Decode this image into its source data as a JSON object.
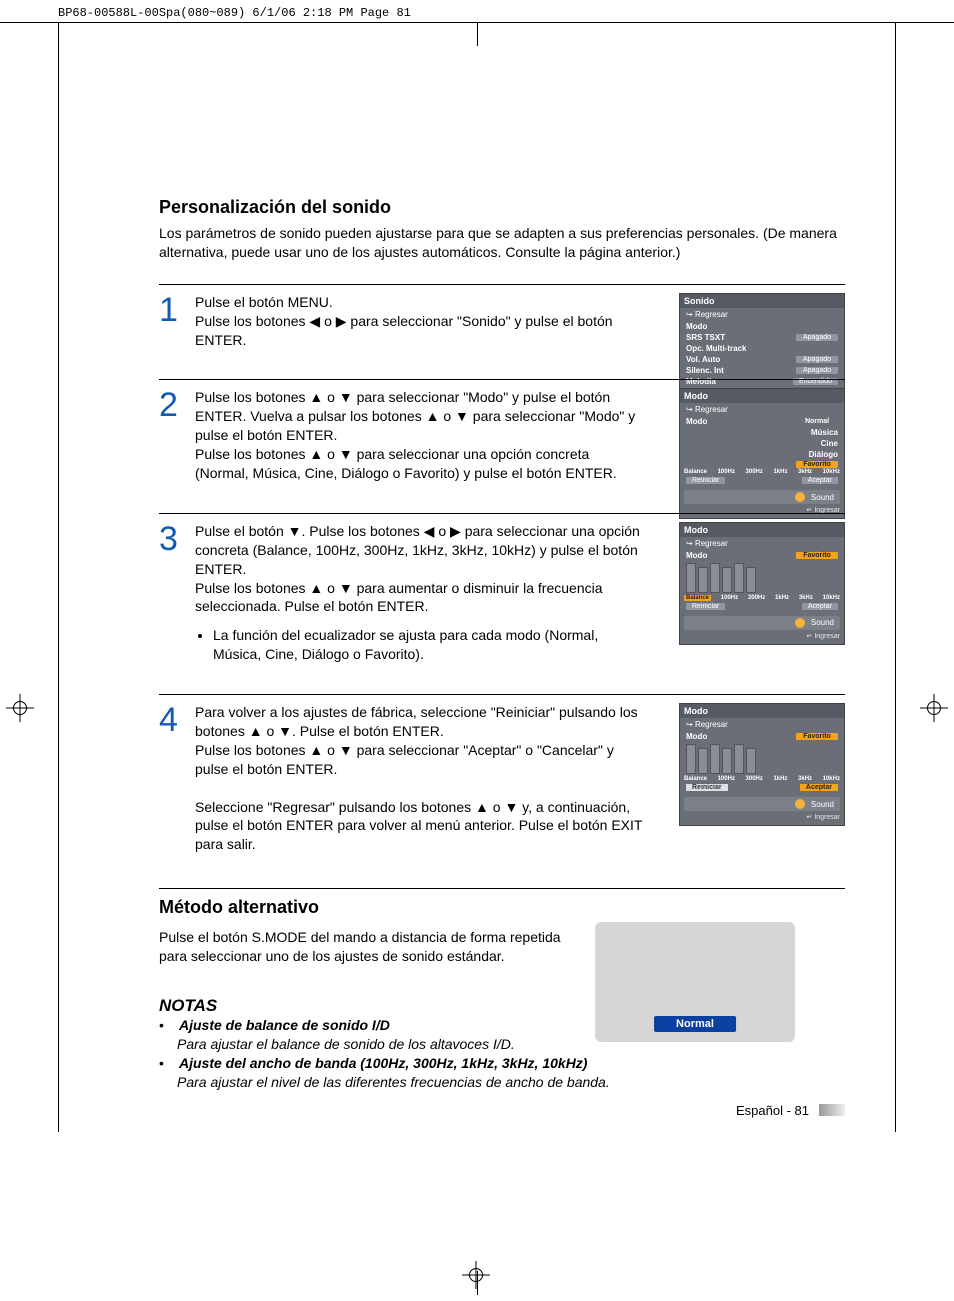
{
  "crop_header": "BP68-00588L-00Spa(080~089)  6/1/06  2:18 PM  Page 81",
  "section_title": "Personalización del sonido",
  "intro": "Los parámetros de sonido pueden ajustarse para que se adapten a sus preferencias personales. (De manera alternativa, puede usar uno de los ajustes automáticos. Consulte la página anterior.)",
  "steps": {
    "s1": {
      "num": "1",
      "t1": "Pulse el botón MENU.",
      "t2_a": "Pulse los botones ",
      "t2_b": " o ",
      "t2_c": " para seleccionar \"Sonido\" y pulse el botón ENTER."
    },
    "s2": {
      "num": "2",
      "t1_a": "Pulse los botones ",
      "t1_b": " o ",
      "t1_c": " para seleccionar \"Modo\" y pulse el botón ENTER. Vuelva a pulsar los botones ",
      "t1_d": " o ",
      "t1_e": " para seleccionar \"Modo\" y pulse el botón ENTER.",
      "t2_a": "Pulse los botones ",
      "t2_b": " o ",
      "t2_c": " para seleccionar una opción concreta (Normal, Música, Cine, Diálogo o Favorito) y pulse el botón ENTER."
    },
    "s3": {
      "num": "3",
      "t1_a": "Pulse el botón ",
      "t1_b": ". Pulse los botones ",
      "t1_c": " o ",
      "t1_d": " para seleccionar una opción concreta (Balance, 100Hz, 300Hz, 1kHz, 3kHz, 10kHz) y pulse el botón ENTER.",
      "t2_a": "Pulse los botones ",
      "t2_b": " o ",
      "t2_c": " para aumentar o disminuir la frecuencia seleccionada. Pulse el botón ENTER.",
      "bullet": "La función del ecualizador se ajusta para cada modo (Normal, Música, Cine, Diálogo o Favorito)."
    },
    "s4": {
      "num": "4",
      "t1_a": "Para volver a los ajustes de fábrica, seleccione \"Reiniciar\" pulsando los botones ",
      "t1_b": " o ",
      "t1_c": ". Pulse el botón ENTER.",
      "t2_a": "Pulse los botones ",
      "t2_b": " o ",
      "t2_c": " para seleccionar \"Aceptar\" o \"Cancelar\" y pulse el botón ENTER.",
      "t3_a": "Seleccione \"Regresar\" pulsando los botones ",
      "t3_b": " o ",
      "t3_c": " y, a continuación, pulse el botón ENTER para volver al menú anterior. Pulse el botón EXIT para salir."
    }
  },
  "alt_title": "Método alternativo",
  "alt_text": "Pulse el botón S.MODE del mando a distancia de forma repetida para seleccionar uno de los ajustes de sonido estándar.",
  "notes_title": "NOTAS",
  "note1_h": "Ajuste de balance de sonido I/D",
  "note1_t": "Para ajustar el balance de sonido de los altavoces I/D.",
  "note2_h": "Ajuste del ancho de banda (100Hz, 300Hz, 1kHz, 3kHz, 10kHz)",
  "note2_t": "Para ajustar el nivel de las diferentes frecuencias de ancho de banda.",
  "footer": "Español - 81",
  "remote_label": "Normal",
  "osd": {
    "ingresar": "Ingresar",
    "sound": "Sound",
    "regresar": "Regresar",
    "sonido": {
      "title": "Sonido",
      "rows": [
        {
          "l": "Modo",
          "v": ""
        },
        {
          "l": "SRS TSXT",
          "v": "Apagado"
        },
        {
          "l": "Opc. Multi-track",
          "v": ""
        },
        {
          "l": "Vol. Auto",
          "v": "Apagado"
        },
        {
          "l": "Silenc. Int",
          "v": "Apagado"
        },
        {
          "l": "Melodía",
          "v": "Encendido"
        }
      ]
    },
    "modo": {
      "title": "Modo",
      "modo_lbl": "Modo",
      "opts": [
        "Normal",
        "Música",
        "Cine",
        "Diálogo",
        "Favorito"
      ],
      "favorito": "Favorito",
      "bands": [
        "Balance",
        "100Hz",
        "300Hz",
        "1kHz",
        "3kHz",
        "10kHz"
      ],
      "reiniciar": "Reiniciar",
      "aceptar": "Aceptar"
    }
  },
  "glyph": {
    "left": "◀",
    "right": "▶",
    "up": "▲",
    "down": "▼"
  }
}
